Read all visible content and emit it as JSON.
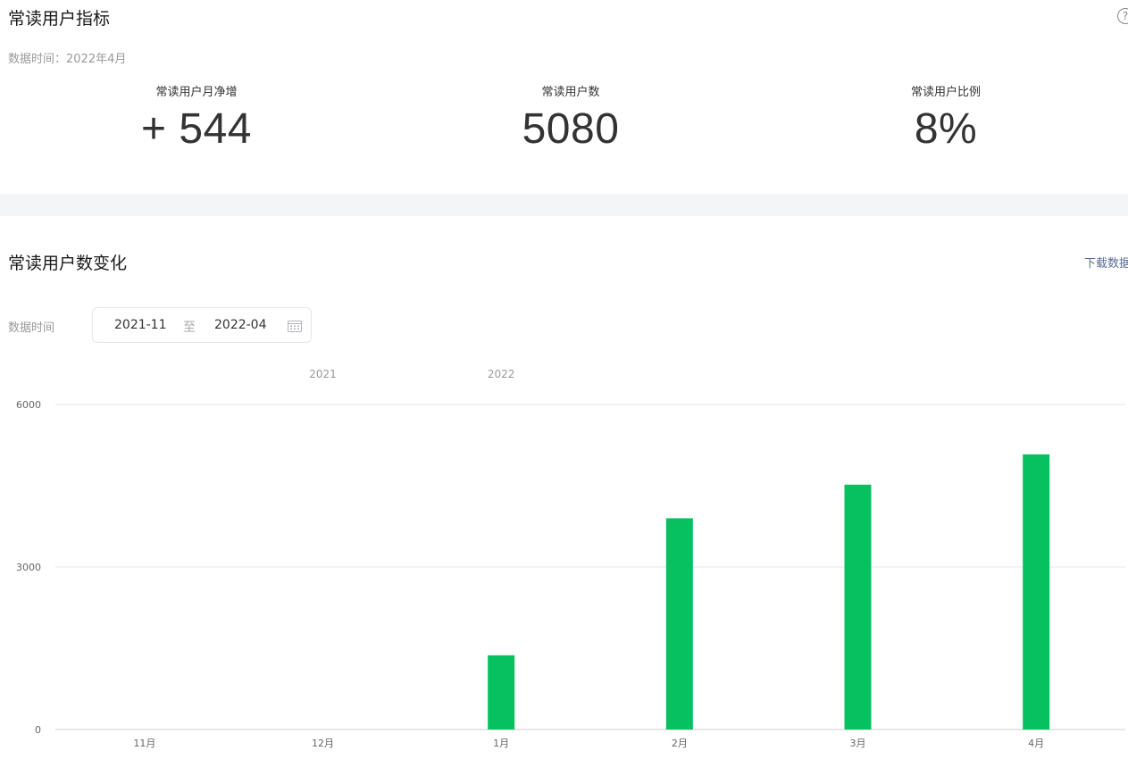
{
  "metrics_panel": {
    "title": "常读用户指标",
    "help_icon": "help-circle-icon",
    "data_time": "数据时间：2022年4月",
    "metrics": [
      {
        "label": "常读用户月净增",
        "value": "+ 544"
      },
      {
        "label": "常读用户数",
        "value": "5080"
      },
      {
        "label": "常读用户比例",
        "value": "8%"
      }
    ]
  },
  "trend_section": {
    "title": "常读用户数变化",
    "download_label": "下载数据",
    "filter_label": "数据时间",
    "date_start": "2021-11",
    "date_separator": "至",
    "date_end": "2022-04",
    "calendar_icon": "calendar-icon"
  },
  "chart_data": {
    "type": "bar",
    "categories": [
      "11月",
      "12月",
      "1月",
      "2月",
      "3月",
      "4月"
    ],
    "year_labels": [
      {
        "label": "2021",
        "category_index": 1
      },
      {
        "label": "2022",
        "category_index": 2
      }
    ],
    "values": [
      0,
      0,
      1370,
      3900,
      4520,
      5080
    ],
    "color": "#07c160",
    "yticks": [
      0,
      3000,
      6000
    ],
    "ylim": [
      0,
      6000
    ],
    "grid": true
  }
}
